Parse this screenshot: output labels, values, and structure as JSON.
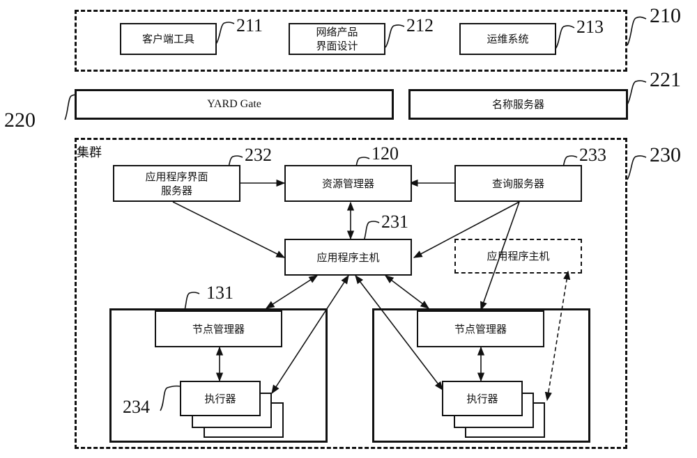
{
  "groups": {
    "client_layer": {
      "ref": "210"
    },
    "cluster": {
      "ref": "230",
      "title": "集群"
    }
  },
  "boxes": {
    "client_tool": {
      "label": "客户端工具",
      "ref": "211"
    },
    "web_ui_design": {
      "label_line1": "网络产品",
      "label_line2": "界面设计",
      "ref": "212"
    },
    "ops_system": {
      "label": "运维系统",
      "ref": "213"
    },
    "yard_gate": {
      "label": "YARD Gate",
      "ref": "220"
    },
    "name_server": {
      "label": "名称服务器",
      "ref": "221"
    },
    "app_ui_server": {
      "label_line1": "应用程序界面",
      "label_line2": "服务器",
      "ref": "232"
    },
    "resource_manager": {
      "label": "资源管理器",
      "ref": "120"
    },
    "query_server": {
      "label": "查询服务器",
      "ref": "233"
    },
    "app_host": {
      "label": "应用程序主机",
      "ref": "231"
    },
    "app_host_dashed": {
      "label": "应用程序主机"
    },
    "node_manager_left": {
      "label": "节点管理器",
      "ref": "131"
    },
    "executor_left": {
      "label": "执行器",
      "ref": "234"
    },
    "node_manager_right": {
      "label": "节点管理器"
    },
    "executor_right": {
      "label": "执行器"
    }
  }
}
